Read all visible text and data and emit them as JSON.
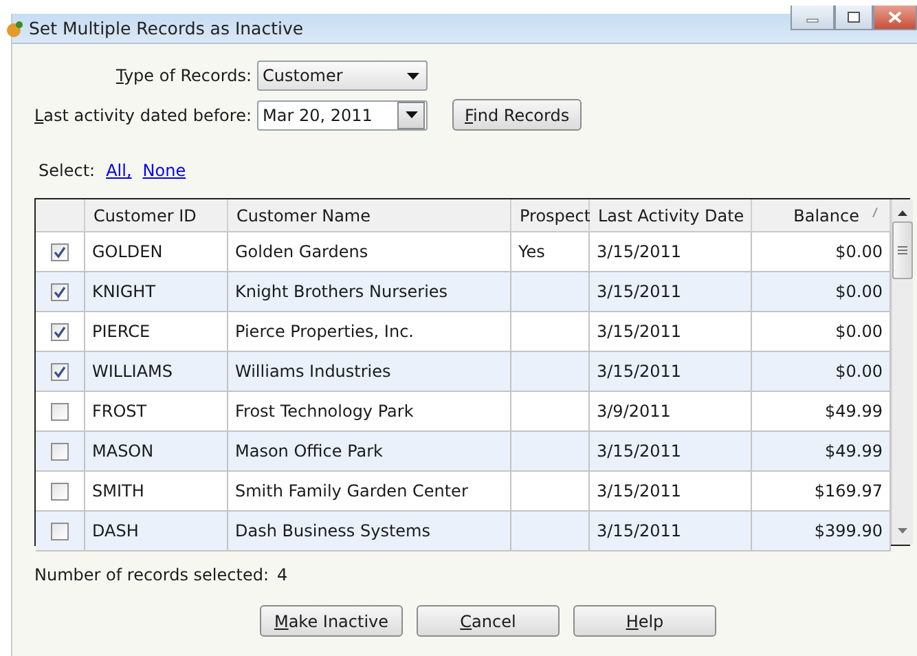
{
  "window": {
    "title": "Set Multiple Records as Inactive"
  },
  "filters": [
    {
      "kind": "dropdown",
      "label": "Type of Records:",
      "value": "Customer"
    },
    {
      "kind": "date",
      "label": "Last activity dated before:",
      "value": "Mar 20, 2011",
      "button": {
        "label": "Find Records"
      }
    }
  ],
  "select": {
    "label": "Select:",
    "links": [
      "All,",
      "None"
    ]
  },
  "table": {
    "columns": [
      {
        "label": "Customer ID",
        "sorted": false
      },
      {
        "label": "Customer Name",
        "sorted": false
      },
      {
        "label": "Prospect",
        "sorted": false
      },
      {
        "label": "Last Activity Date",
        "sorted": false
      },
      {
        "label": "Balance",
        "sorted": true
      }
    ],
    "rows": [
      {
        "checked": true,
        "cells": [
          "GOLDEN",
          "Golden Gardens",
          "Yes",
          "3/15/2011",
          "$0.00"
        ]
      },
      {
        "checked": true,
        "cells": [
          "KNIGHT",
          "Knight Brothers Nurseries",
          "",
          "3/15/2011",
          "$0.00"
        ]
      },
      {
        "checked": true,
        "cells": [
          "PIERCE",
          "Pierce Properties, Inc.",
          "",
          "3/15/2011",
          "$0.00"
        ]
      },
      {
        "checked": true,
        "cells": [
          "WILLIAMS",
          "Williams Industries",
          "",
          "3/15/2011",
          "$0.00"
        ]
      },
      {
        "checked": false,
        "cells": [
          "FROST",
          "Frost Technology Park",
          "",
          "3/9/2011",
          "$49.99"
        ]
      },
      {
        "checked": false,
        "cells": [
          "MASON",
          "Mason Office Park",
          "",
          "3/15/2011",
          "$49.99"
        ]
      },
      {
        "checked": false,
        "cells": [
          "SMITH",
          "Smith Family Garden Center",
          "",
          "3/15/2011",
          "$169.97"
        ]
      },
      {
        "checked": false,
        "cells": [
          "DASH",
          "Dash Business Systems",
          "",
          "3/15/2011",
          "$399.90"
        ]
      }
    ]
  },
  "status": {
    "label": "Number of records selected:",
    "value": "4"
  },
  "buttons": [
    {
      "label": "Make Inactive"
    },
    {
      "label": "Cancel"
    },
    {
      "label": "Help"
    }
  ]
}
